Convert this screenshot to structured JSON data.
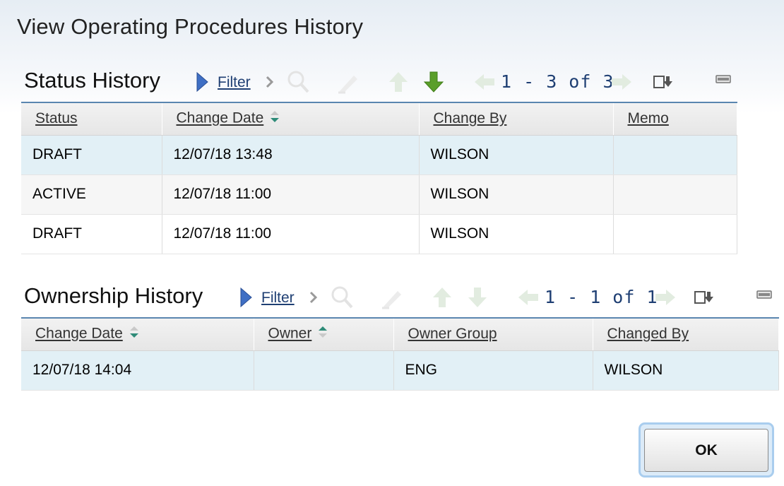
{
  "dialog": {
    "title": "View Operating Procedures History"
  },
  "status_history": {
    "title": "Status History",
    "filter_label": "Filter",
    "pager": "1 - 3 of 3",
    "columns": [
      "Status",
      "Change Date",
      "Change By",
      "Memo"
    ],
    "rows": [
      {
        "status": "DRAFT",
        "change_date": "12/07/18 13:48",
        "change_by": "WILSON",
        "memo": ""
      },
      {
        "status": "ACTIVE",
        "change_date": "12/07/18 11:00",
        "change_by": "WILSON",
        "memo": ""
      },
      {
        "status": "DRAFT",
        "change_date": "12/07/18 11:00",
        "change_by": "WILSON",
        "memo": ""
      }
    ]
  },
  "ownership_history": {
    "title": "Ownership History",
    "filter_label": "Filter",
    "pager": "1 - 1 of 1",
    "columns": [
      "Change Date",
      "Owner",
      "Owner Group",
      "Changed By"
    ],
    "rows": [
      {
        "change_date": "12/07/18 14:04",
        "owner": "",
        "owner_group": "ENG",
        "changed_by": "WILSON"
      }
    ]
  },
  "footer": {
    "ok_label": "OK"
  },
  "colors": {
    "accent_blue": "#1f3f73",
    "selected_row": "#e2f0f6",
    "table_border": "#5a86b0",
    "download_green": "#5a9e2a"
  },
  "icons": [
    "filter-toggle-icon",
    "chevron-right-icon",
    "search-icon",
    "clear-filter-icon",
    "arrow-up-icon",
    "arrow-down-icon",
    "previous-page-icon",
    "next-page-icon",
    "download-icon",
    "minimize-icon",
    "sort-icon"
  ]
}
